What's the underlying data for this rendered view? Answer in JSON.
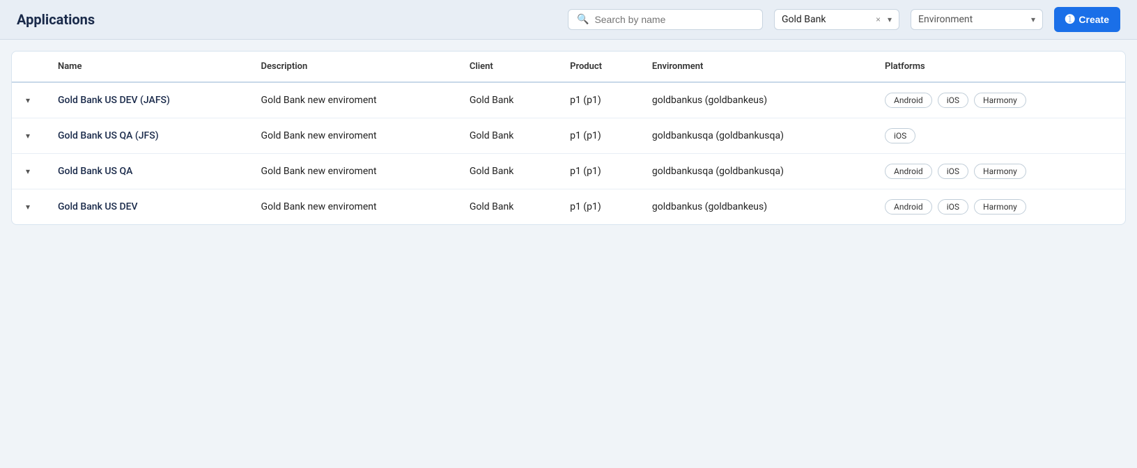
{
  "header": {
    "title": "Applications",
    "search_placeholder": "Search by name",
    "filter": {
      "value": "Gold Bank",
      "clear_label": "×",
      "chevron": "▾"
    },
    "environment": {
      "placeholder": "Environment",
      "chevron": "▾"
    },
    "create_button": "Create"
  },
  "table": {
    "columns": [
      "",
      "Name",
      "Description",
      "Client",
      "Product",
      "Environment",
      "Platforms"
    ],
    "rows": [
      {
        "id": "row-1",
        "name": "Gold Bank US DEV (JAFS)",
        "description": "Gold Bank new enviroment",
        "client": "Gold Bank",
        "product": "p1 (p1)",
        "environment": "goldbankus (goldbankeus)",
        "platforms": [
          "Android",
          "iOS",
          "Harmony"
        ]
      },
      {
        "id": "row-2",
        "name": "Gold Bank US QA (JFS)",
        "description": "Gold Bank new enviroment",
        "client": "Gold Bank",
        "product": "p1 (p1)",
        "environment": "goldbankusqa (goldbankusqa)",
        "platforms": [
          "iOS"
        ]
      },
      {
        "id": "row-3",
        "name": "Gold Bank US QA",
        "description": "Gold Bank new enviroment",
        "client": "Gold Bank",
        "product": "p1 (p1)",
        "environment": "goldbankusqa (goldbankusqa)",
        "platforms": [
          "Android",
          "iOS",
          "Harmony"
        ]
      },
      {
        "id": "row-4",
        "name": "Gold Bank US DEV",
        "description": "Gold Bank new enviroment",
        "client": "Gold Bank",
        "product": "p1 (p1)",
        "environment": "goldbankus (goldbankeus)",
        "platforms": [
          "Android",
          "iOS",
          "Harmony"
        ]
      }
    ]
  }
}
